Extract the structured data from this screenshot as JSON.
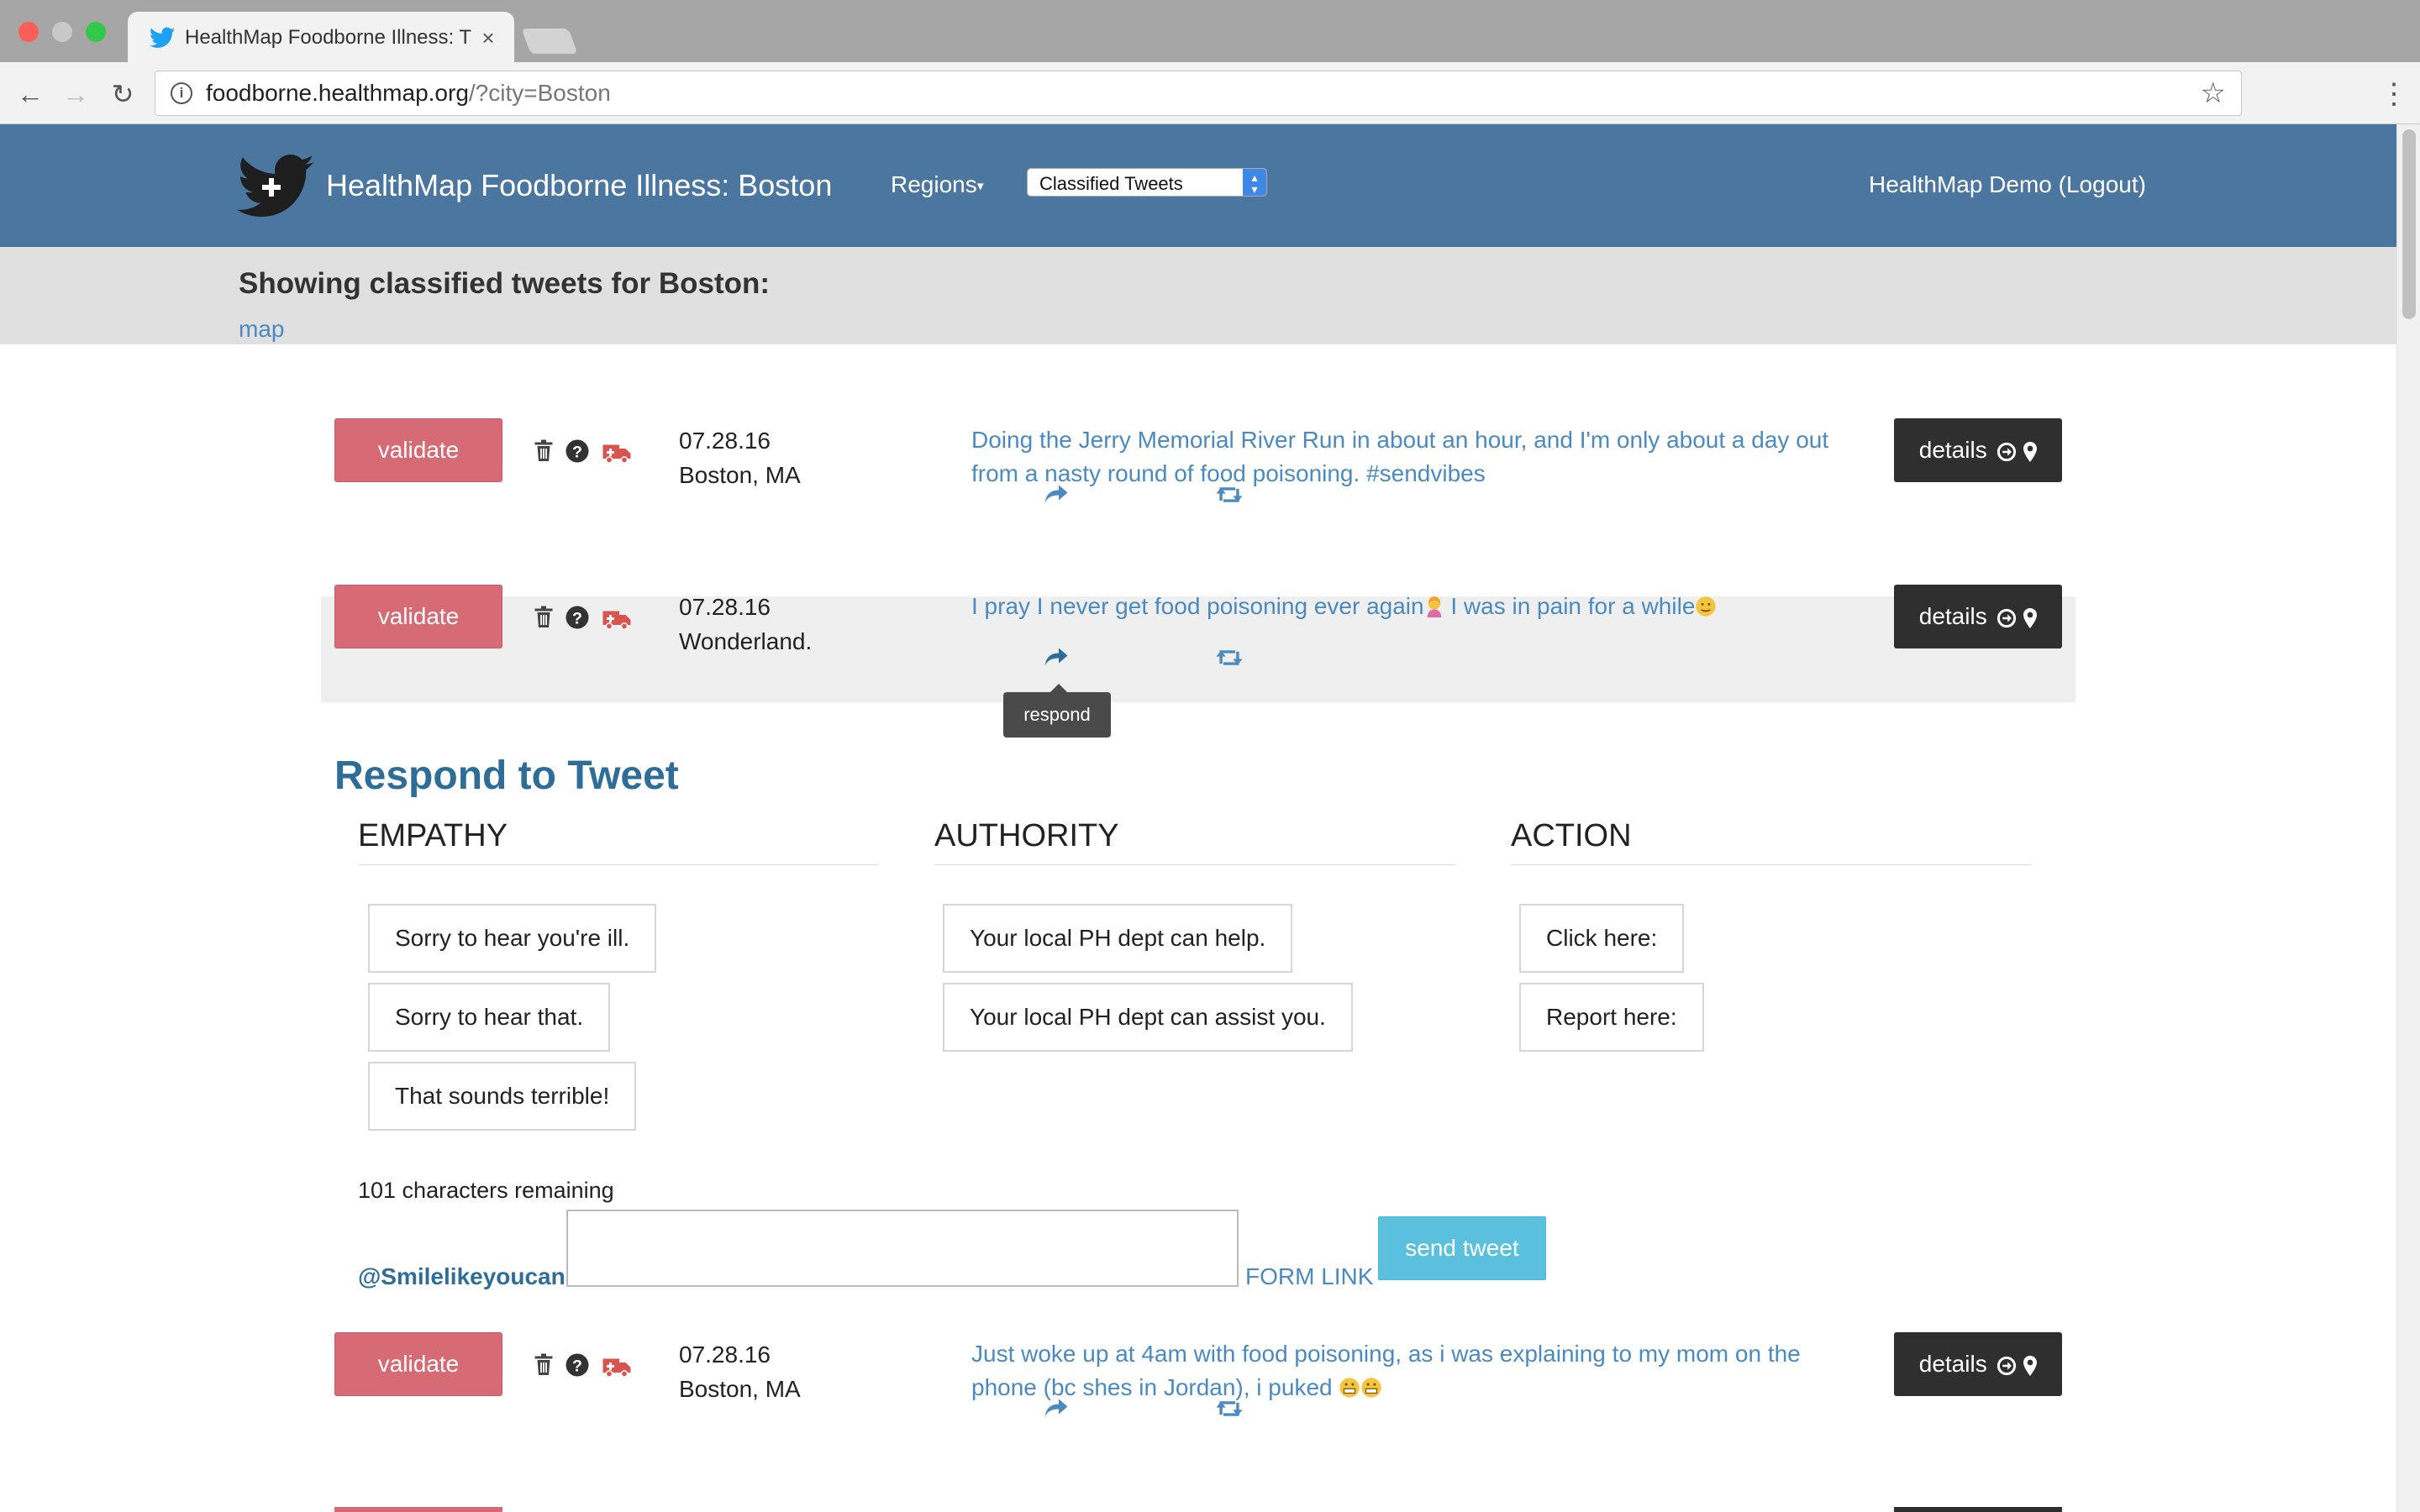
{
  "browser": {
    "tab_title": "HealthMap Foodborne Illness: T",
    "tab_close": "×",
    "url_host": "foodborne.healthmap.org",
    "url_path": "/?city=Boston"
  },
  "navbar": {
    "brand": "HealthMap Foodborne Illness: Boston",
    "regions_label": "Regions",
    "select_value": "Classified Tweets",
    "user_link": "HealthMap Demo (Logout)"
  },
  "subheader": {
    "title": "Showing classified tweets for Boston:",
    "map_link": "map"
  },
  "tweets": [
    {
      "validate": "validate",
      "date": "07.28.16",
      "location": "Boston, MA",
      "text_line1": "Doing the Jerry Memorial River Run in about an hour, and I'm only about a day out",
      "text_line2": "from a nasty round of food poisoning. #sendvibes",
      "details": "details"
    },
    {
      "validate": "validate",
      "date": "07.28.16",
      "location": "Wonderland.",
      "text_part1": "I pray I never get food poisoning ever again",
      "text_part2": " I was in pain for a while",
      "details": "details"
    },
    {
      "validate": "validate",
      "date": "07.28.16",
      "location": "Boston, MA",
      "text_line1": "Just woke up at 4am with food poisoning, as i was explaining to my mom on the",
      "text_line2": "phone (bc shes in Jordan), i puked ",
      "details": "details"
    }
  ],
  "tooltip": "respond",
  "respond": {
    "title": "Respond to Tweet",
    "columns": [
      {
        "heading": "EMPATHY",
        "options": [
          "Sorry to hear you're ill.",
          "Sorry to hear that.",
          "That sounds terrible!"
        ]
      },
      {
        "heading": "AUTHORITY",
        "options": [
          "Your local PH dept can help.",
          "Your local PH dept can assist you."
        ]
      },
      {
        "heading": "ACTION",
        "options": [
          "Click here:",
          "Report here:"
        ]
      }
    ],
    "chars_remaining": "101 characters remaining",
    "handle": "@Smilelikeyoucan",
    "reply_value": "",
    "form_link": "FORM LINK",
    "send_label": "send tweet"
  },
  "colors": {
    "navbar": "#4a76a0",
    "validate": "#d66b75",
    "details": "#2f2f2f",
    "link": "#4a8ac0",
    "send": "#5bc0de"
  },
  "icons": [
    "twitter-icon",
    "trash-icon",
    "question-icon",
    "ambulance-icon",
    "reply-icon",
    "retweet-icon",
    "arrow-circle-right-icon",
    "map-marker-icon",
    "star-icon",
    "info-icon"
  ]
}
